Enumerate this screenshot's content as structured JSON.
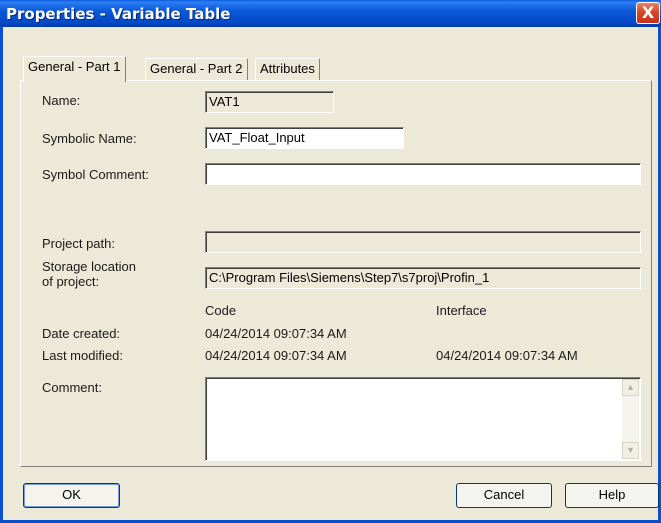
{
  "window": {
    "title": "Properties - Variable Table",
    "close_glyph": "X"
  },
  "tabs": [
    {
      "label": "General - Part 1",
      "active": true
    },
    {
      "label": "General - Part 2",
      "active": false
    },
    {
      "label": "Attributes",
      "active": false
    }
  ],
  "form": {
    "name_label": "Name:",
    "name_value": "VAT1",
    "symbolic_name_label": "Symbolic Name:",
    "symbolic_name_value": "VAT_Float_Input",
    "symbol_comment_label": "Symbol Comment:",
    "symbol_comment_value": "",
    "project_path_label": "Project path:",
    "project_path_value": "",
    "storage_location_label_line1": "Storage location",
    "storage_location_label_line2": "of project:",
    "storage_location_value": "C:\\Program Files\\Siemens\\Step7\\s7proj\\Profin_1",
    "col_code": "Code",
    "col_interface": "Interface",
    "date_created_label": "Date created:",
    "date_created_code": "04/24/2014 09:07:34 AM",
    "last_modified_label": "Last modified:",
    "last_modified_code": "04/24/2014 09:07:34 AM",
    "last_modified_interface": "04/24/2014 09:07:34 AM",
    "comment_label": "Comment:",
    "comment_value": ""
  },
  "buttons": {
    "ok": "OK",
    "cancel": "Cancel",
    "help": "Help"
  },
  "colors": {
    "titlebar": "#0a59d9",
    "dialog_bg": "#ece9d8",
    "close_button": "#d7492a"
  }
}
